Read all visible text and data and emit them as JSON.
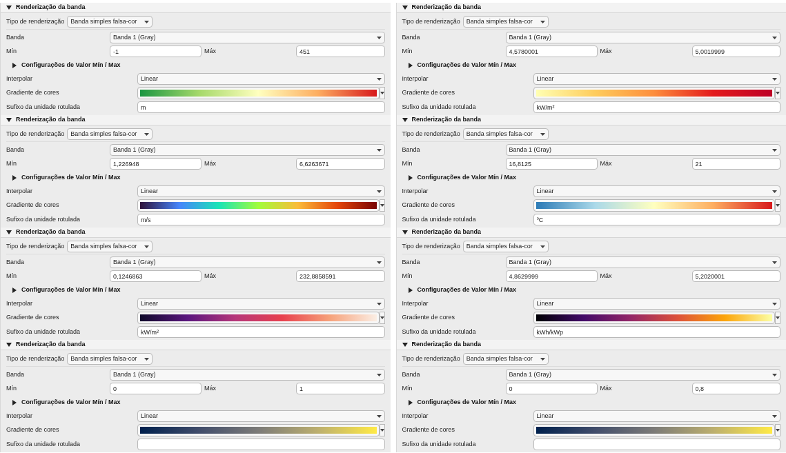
{
  "panels": [
    {
      "title": "Renderização da banda",
      "expanded": true,
      "render_type_label": "Tipo de renderização",
      "render_type": "Banda simples falsa-cor",
      "band_label": "Banda",
      "band": "Banda 1 (Gray)",
      "min_label": "Mín",
      "min": "-1",
      "max_label": "Máx",
      "max": "451",
      "minmax_section": "Configurações de Valor Mín / Max",
      "minmax_expanded": false,
      "interp_label": "Interpolar",
      "interp": "Linear",
      "ramp_label": "Gradiente de cores",
      "ramp": {
        "kind": "rdylgn"
      },
      "suffix_label": "Sufixo da unidade rotulada",
      "suffix": "m"
    },
    {
      "title": "Renderização da banda",
      "expanded": true,
      "render_type_label": "Tipo de renderização",
      "render_type": "Banda simples falsa-cor",
      "band_label": "Banda",
      "band": "Banda 1 (Gray)",
      "min_label": "Mín",
      "min": "4,5780001",
      "max_label": "Máx",
      "max": "5,0019999",
      "minmax_section": "Configurações de Valor Mín / Max",
      "minmax_expanded": false,
      "interp_label": "Interpolar",
      "interp": "Linear",
      "ramp_label": "Gradiente de cores",
      "ramp": {
        "kind": "ylorrd"
      },
      "suffix_label": "Sufixo da unidade rotulada",
      "suffix": "kW/m²"
    },
    {
      "title": "Renderização da banda",
      "expanded": true,
      "render_type_label": "Tipo de renderização",
      "render_type": "Banda simples falsa-cor",
      "band_label": "Banda",
      "band": "Banda 1 (Gray)",
      "min_label": "Mín",
      "min": "1,226948",
      "max_label": "Máx",
      "max": "6,6263671",
      "minmax_section": "Configurações de Valor Mín / Max",
      "minmax_expanded": false,
      "interp_label": "Interpolar",
      "interp": "Linear",
      "ramp_label": "Gradiente de cores",
      "ramp": {
        "kind": "turbo"
      },
      "suffix_label": "Sufixo da unidade rotulada",
      "suffix": "m/s"
    },
    {
      "title": "Renderização da banda",
      "expanded": true,
      "render_type_label": "Tipo de renderização",
      "render_type": "Banda simples falsa-cor",
      "band_label": "Banda",
      "band": "Banda 1 (Gray)",
      "min_label": "Mín",
      "min": "16,8125",
      "max_label": "Máx",
      "max": "21",
      "minmax_section": "Configurações de Valor Mín / Max",
      "minmax_expanded": false,
      "interp_label": "Interpolar",
      "interp": "Linear",
      "ramp_label": "Gradiente de cores",
      "ramp": {
        "kind": "rdylbu"
      },
      "suffix_label": "Sufixo da unidade rotulada",
      "suffix": "ºC"
    },
    {
      "title": "Renderização da banda",
      "expanded": true,
      "render_type_label": "Tipo de renderização",
      "render_type": "Banda simples falsa-cor",
      "band_label": "Banda",
      "band": "Banda 1 (Gray)",
      "min_label": "Mín",
      "min": "0,1246863",
      "max_label": "Máx",
      "max": "232,8858591",
      "minmax_section": "Configurações de Valor Mín / Max",
      "minmax_expanded": false,
      "interp_label": "Interpolar",
      "interp": "Linear",
      "ramp_label": "Gradiente de cores",
      "ramp": {
        "kind": "rocket"
      },
      "suffix_label": "Sufixo da unidade rotulada",
      "suffix": "kW/m²"
    },
    {
      "title": "Renderização da banda",
      "expanded": true,
      "render_type_label": "Tipo de renderização",
      "render_type": "Banda simples falsa-cor",
      "band_label": "Banda",
      "band": "Banda 1 (Gray)",
      "min_label": "Mín",
      "min": "4,8629999",
      "max_label": "Máx",
      "max": "5,2020001",
      "minmax_section": "Configurações de Valor Mín / Max",
      "minmax_expanded": false,
      "interp_label": "Interpolar",
      "interp": "Linear",
      "ramp_label": "Gradiente de cores",
      "ramp": {
        "kind": "inferno"
      },
      "suffix_label": "Sufixo da unidade rotulada",
      "suffix": "kWh/kWp"
    },
    {
      "title": "Renderização da banda",
      "expanded": true,
      "render_type_label": "Tipo de renderização",
      "render_type": "Banda simples falsa-cor",
      "band_label": "Banda",
      "band": "Banda 1 (Gray)",
      "min_label": "Mín",
      "min": "0",
      "max_label": "Máx",
      "max": "1",
      "minmax_section": "Configurações de Valor Mín / Max",
      "minmax_expanded": false,
      "interp_label": "Interpolar",
      "interp": "Linear",
      "ramp_label": "Gradiente de cores",
      "ramp": {
        "kind": "cividis"
      },
      "suffix_label": "Sufixo da unidade rotulada"
    },
    {
      "title": "Renderização da banda",
      "expanded": true,
      "render_type_label": "Tipo de renderização",
      "render_type": "Banda simples falsa-cor",
      "band_label": "Banda",
      "band": "Banda 1 (Gray)",
      "min_label": "Mín",
      "min": "0",
      "max_label": "Máx",
      "max": "0,8",
      "minmax_section": "Configurações de Valor Mín / Max",
      "minmax_expanded": false,
      "interp_label": "Interpolar",
      "interp": "Linear",
      "ramp_label": "Gradiente de cores",
      "ramp": {
        "kind": "cividis"
      },
      "suffix_label": "Sufixo da unidade rotulada"
    }
  ]
}
